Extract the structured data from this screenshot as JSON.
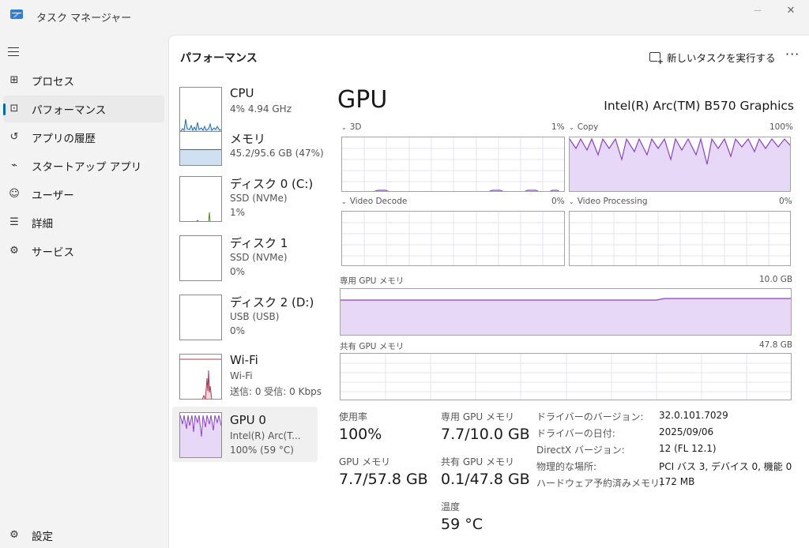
{
  "app": {
    "title": "タスク マネージャー"
  },
  "window_controls": {
    "minimize": "—",
    "maximize": "☐",
    "close": "✕"
  },
  "sidebar": {
    "items": [
      {
        "label": "プロセス",
        "icon": "processes-icon"
      },
      {
        "label": "パフォーマンス",
        "icon": "performance-icon"
      },
      {
        "label": "アプリの履歴",
        "icon": "history-icon"
      },
      {
        "label": "スタートアップ アプリ",
        "icon": "startup-icon"
      },
      {
        "label": "ユーザー",
        "icon": "users-icon"
      },
      {
        "label": "詳細",
        "icon": "details-icon"
      },
      {
        "label": "サービス",
        "icon": "services-icon"
      }
    ],
    "settings_label": "設定"
  },
  "header": {
    "title": "パフォーマンス",
    "run_task_label": "新しいタスクを実行する",
    "more_label": "···"
  },
  "devices": [
    {
      "name": "CPU",
      "sub1": "4% 4.94 GHz",
      "sub2": "",
      "color": "#1f6fb2"
    },
    {
      "name": "メモリ",
      "sub1": "45.2/95.6 GB (47%)",
      "sub2": "",
      "color": "#1f6fb2",
      "level": 0.47
    },
    {
      "name": "ディスク 0 (C:)",
      "sub1": "SSD (NVMe)",
      "sub2": "1%",
      "color": "#4e8a1e"
    },
    {
      "name": "ディスク 1",
      "sub1": "SSD (NVMe)",
      "sub2": "0%",
      "color": "#4e8a1e"
    },
    {
      "name": "ディスク 2 (D:)",
      "sub1": "USB (USB)",
      "sub2": "0%",
      "color": "#4e8a1e"
    },
    {
      "name": "Wi-Fi",
      "sub1": "Wi-Fi",
      "sub2": "送信: 0 受信: 0 Kbps",
      "color": "#a73c54"
    },
    {
      "name": "GPU 0",
      "sub1": "Intel(R) Arc(T...",
      "sub2": "100% (59 °C)",
      "color": "#8a3fd2"
    }
  ],
  "gpu": {
    "title": "GPU",
    "model": "Intel(R) Arc(TM) B570 Graphics",
    "graphs": {
      "3d": {
        "label": "3D",
        "value": "1%"
      },
      "copy": {
        "label": "Copy",
        "value": "100%"
      },
      "video_decode": {
        "label": "Video Decode",
        "value": "0%"
      },
      "video_processing": {
        "label": "Video Processing",
        "value": "0%"
      },
      "dedicated": {
        "label": "専用 GPU メモリ",
        "value": "10.0 GB"
      },
      "shared": {
        "label": "共有 GPU メモリ",
        "value": "47.8 GB"
      }
    },
    "stats": {
      "utilization_label": "使用率",
      "utilization_value": "100%",
      "dedicated_label": "専用 GPU メモリ",
      "dedicated_value": "7.7/10.0 GB",
      "gpu_memory_label": "GPU メモリ",
      "gpu_memory_value": "7.7/57.8 GB",
      "shared_label": "共有 GPU メモリ",
      "shared_value": "0.1/47.8 GB",
      "temp_label": "温度",
      "temp_value": "59 °C"
    },
    "properties": [
      {
        "key": "ドライバーのバージョン:",
        "value": "32.0.101.7029"
      },
      {
        "key": "ドライバーの日付:",
        "value": "2025/09/06"
      },
      {
        "key": "DirectX バージョン:",
        "value": "12 (FL 12.1)"
      },
      {
        "key": "物理的な場所:",
        "value": "PCI バス 3, デバイス 0, 機能 0"
      },
      {
        "key": "ハードウェア予約済みメモリ:",
        "value": "172 MB"
      }
    ]
  },
  "colors": {
    "accent": "#0067c0",
    "gpu_line": "#8a3fd2",
    "gpu_fill": "#e8d8f7"
  }
}
